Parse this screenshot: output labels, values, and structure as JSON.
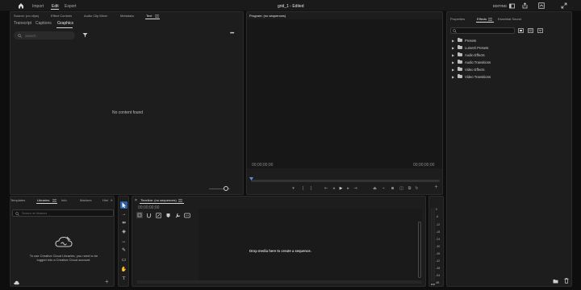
{
  "topbar": {
    "nav": [
      "Import",
      "Edit",
      "Export"
    ],
    "active_nav_index": 1,
    "title": "grid_1 - Edited",
    "workspace_label": "EDITING"
  },
  "source_panel": {
    "tabs": [
      "Source: (no clips)",
      "Effect Controls",
      "Audio Clip Mixer",
      "Metadata",
      "Text"
    ],
    "active_tab_index": 4,
    "subtabs": [
      "Transcript",
      "Captions",
      "Graphics"
    ],
    "active_subtab_index": 2,
    "search_placeholder": "Search",
    "empty_message": "No content found"
  },
  "program_panel": {
    "title": "Program: (no sequences)",
    "timecode_left": "00;00;00;00",
    "timecode_right": "00;00;00;00"
  },
  "effects_panel": {
    "tabs": [
      "Properties",
      "Effects",
      "Essential Sound"
    ],
    "active_tab_index": 1,
    "tree": [
      "Presets",
      "Lumetri Presets",
      "Audio Effects",
      "Audio Transitions",
      "Video Effects",
      "Video Transitions"
    ]
  },
  "project_panel": {
    "tabs": [
      "Templates",
      "Libraries",
      "Info",
      "Markers",
      "Hist"
    ],
    "active_tab_index": 1,
    "search_placeholder": "Search all libraries",
    "cc_message": "To use Creative Cloud Libraries, you need to be logged into a Creative Cloud account."
  },
  "timeline_panel": {
    "title": "Timeline: (no sequences)",
    "timecode": "00;00;00;00",
    "drop_message": "Drop media here to create a sequence."
  },
  "audio_meter": {
    "ticks": [
      "0",
      "-6",
      "-12",
      "-18",
      "-24",
      "-30",
      "-36",
      "-42",
      "-48",
      "-54",
      "dB"
    ]
  }
}
